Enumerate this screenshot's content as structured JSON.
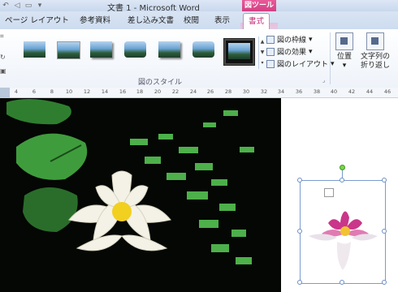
{
  "window": {
    "title": "文書 1 - Microsoft Word"
  },
  "contextual": {
    "header": "図ツール"
  },
  "tabs": [
    "ページ レイアウト",
    "参考資料",
    "差し込み文書",
    "校閲",
    "表示",
    "書式"
  ],
  "active_tab": "書式",
  "ribbon": {
    "picture_styles_group": "図のスタイル",
    "commands": {
      "picture_border": "図の枠線",
      "picture_effects": "図の効果",
      "picture_layout": "図のレイアウト",
      "position": "位置",
      "wrap_text_line1": "文字列の",
      "wrap_text_line2": "折り返し"
    }
  },
  "ruler": {
    "numbers": [
      "4",
      "6",
      "8",
      "10",
      "12",
      "14",
      "16",
      "18",
      "20",
      "22",
      "24",
      "26",
      "28",
      "30",
      "32",
      "34",
      "36",
      "38",
      "40",
      "42",
      "44",
      "46"
    ]
  },
  "colors": {
    "accent_pink": "#d23f83",
    "ribbon_blue": "#cddcf0",
    "selection": "#7b9bcf",
    "rotate_handle": "#7bd24b"
  }
}
